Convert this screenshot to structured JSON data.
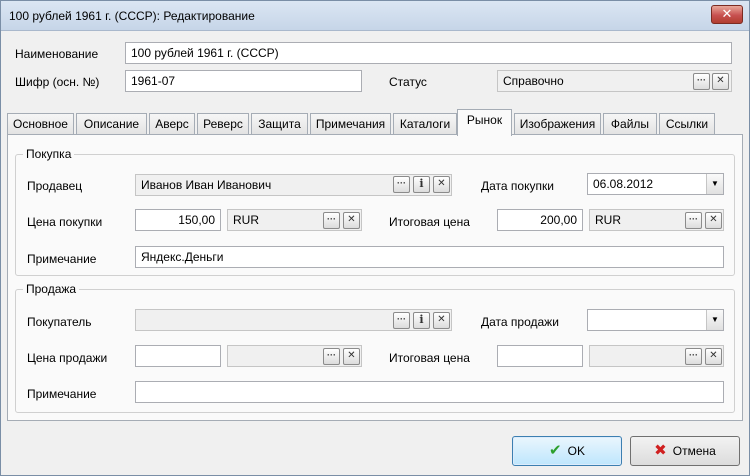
{
  "window": {
    "title": "100 рублей 1961 г. (СССР): Редактирование",
    "close_glyph": "✕"
  },
  "header": {
    "name_label": "Наименование",
    "name_value": "100 рублей 1961 г. (СССР)",
    "code_label": "Шифр (осн. №)",
    "code_value": "1961-07",
    "status_label": "Статус",
    "status_value": "Справочно"
  },
  "tabs": [
    {
      "label": "Основное"
    },
    {
      "label": "Описание"
    },
    {
      "label": "Аверс"
    },
    {
      "label": "Реверс"
    },
    {
      "label": "Защита"
    },
    {
      "label": "Примечания"
    },
    {
      "label": "Каталоги"
    },
    {
      "label": "Рынок",
      "active": true
    },
    {
      "label": "Изображения"
    },
    {
      "label": "Файлы"
    },
    {
      "label": "Ссылки"
    }
  ],
  "purchase": {
    "group_title": "Покупка",
    "seller_label": "Продавец",
    "seller_value": "Иванов Иван Иванович",
    "date_label": "Дата покупки",
    "date_value": "06.08.2012",
    "price_label": "Цена покупки",
    "price_value": "150,00",
    "price_currency": "RUR",
    "total_label": "Итоговая цена",
    "total_value": "200,00",
    "total_currency": "RUR",
    "note_label": "Примечание",
    "note_value": "Яндекс.Деньги"
  },
  "sale": {
    "group_title": "Продажа",
    "buyer_label": "Покупатель",
    "buyer_value": "",
    "date_label": "Дата продажи",
    "date_value": "",
    "price_label": "Цена продажи",
    "price_value": "",
    "price_currency": "",
    "total_label": "Итоговая цена",
    "total_value": "",
    "total_currency": "",
    "note_label": "Примечание",
    "note_value": ""
  },
  "glyphs": {
    "dots": "···",
    "info": "i",
    "clear": "✕",
    "dropdown": "▼",
    "ok": "✔",
    "cancel": "✖"
  },
  "footer": {
    "ok_label": "OK",
    "cancel_label": "Отмена"
  }
}
